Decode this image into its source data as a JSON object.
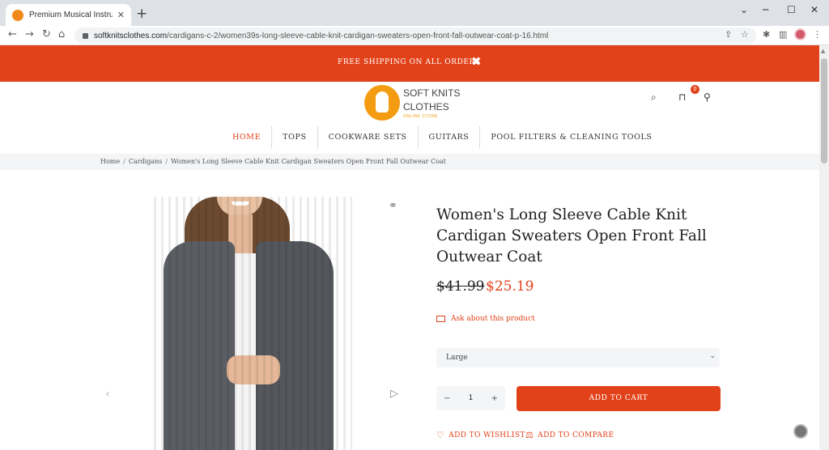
{
  "browser": {
    "tab_title": "Premium Musical Instruments o",
    "tab_close": "✕",
    "new_tab": "+",
    "url_domain": "softknitsclothes.com",
    "url_path": "/cardigans-c-2/women39s-long-sleeve-cable-knit-cardigan-sweaters-open-front-fall-outwear-coat-p-16.html",
    "win_min": "─",
    "win_max": "☐",
    "win_close": "✕",
    "back": "←",
    "forward": "→",
    "reload": "↻",
    "home": "⌂"
  },
  "banner": {
    "text": "FREE SHIPPING ON ALL ORDERS",
    "close": "✖"
  },
  "logo": {
    "line1": "SOFT KNITS",
    "line2": "CLOTHES",
    "tagline": "ONLINE STORE"
  },
  "header": {
    "cart_count": "0"
  },
  "nav": {
    "items": [
      {
        "label": "HOME"
      },
      {
        "label": "TOPS"
      },
      {
        "label": "COOKWARE SETS"
      },
      {
        "label": "GUITARS"
      },
      {
        "label": "POOL FILTERS & CLEANING TOOLS"
      }
    ]
  },
  "breadcrumb": [
    "Home",
    "Cardigans",
    "Women's Long Sleeve Cable Knit Cardigan Sweaters Open Front Fall Outwear Coat"
  ],
  "breadcrumb_sep": "/",
  "product": {
    "title": "Women's Long Sleeve Cable Knit Cardigan Sweaters Open Front Fall Outwear Coat",
    "price_old": "$41.99",
    "price_new": "$25.19",
    "ask_label": "Ask about this product",
    "size_selected": "Large",
    "qty_minus": "−",
    "qty_value": "1",
    "qty_plus": "+",
    "add_to_cart": "ADD TO CART",
    "wishlist": "ADD TO WISHLIST",
    "compare": "ADD TO COMPARE"
  },
  "colors": {
    "accent": "#e2421a",
    "logo": "#f39c12"
  }
}
